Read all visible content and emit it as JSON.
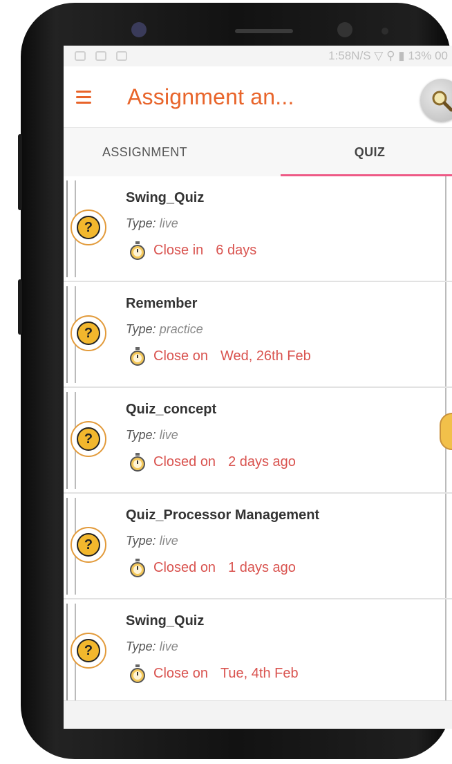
{
  "status_bar": {
    "text": "1:58N/S  ▽  ⚲  ▮  13% 00"
  },
  "app_bar": {
    "title": "Assignment an...",
    "menu_icon": "hamburger-menu-icon",
    "search_icon": "search-icon",
    "accent_color": "#e8642a"
  },
  "tabs": [
    {
      "label": "ASSIGNMENT",
      "active": false
    },
    {
      "label": "QUIZ",
      "active": true
    }
  ],
  "tab_indicator_color": "#ee5a86",
  "quizzes": [
    {
      "title": "Swing_Quiz",
      "type_label": "Type:",
      "type_value": "live",
      "close_label": "Close in",
      "close_value": "6 days"
    },
    {
      "title": "Remember",
      "type_label": "Type:",
      "type_value": "practice",
      "close_label": "Close on",
      "close_value": "Wed, 26th  Feb"
    },
    {
      "title": "Quiz_concept",
      "type_label": "Type:",
      "type_value": "live",
      "close_label": "Closed on",
      "close_value": "2 days ago"
    },
    {
      "title": "Quiz_Processor Management",
      "type_label": "Type:",
      "type_value": "live",
      "close_label": "Closed on",
      "close_value": "1 days ago"
    },
    {
      "title": "Swing_Quiz",
      "type_label": "Type:",
      "type_value": "live",
      "close_label": "Close on",
      "close_value": "Tue, 4th  Feb"
    }
  ],
  "quiz_icon": "question-mark-icon",
  "timer_icon": "stopwatch-icon",
  "close_color": "#d9534f"
}
